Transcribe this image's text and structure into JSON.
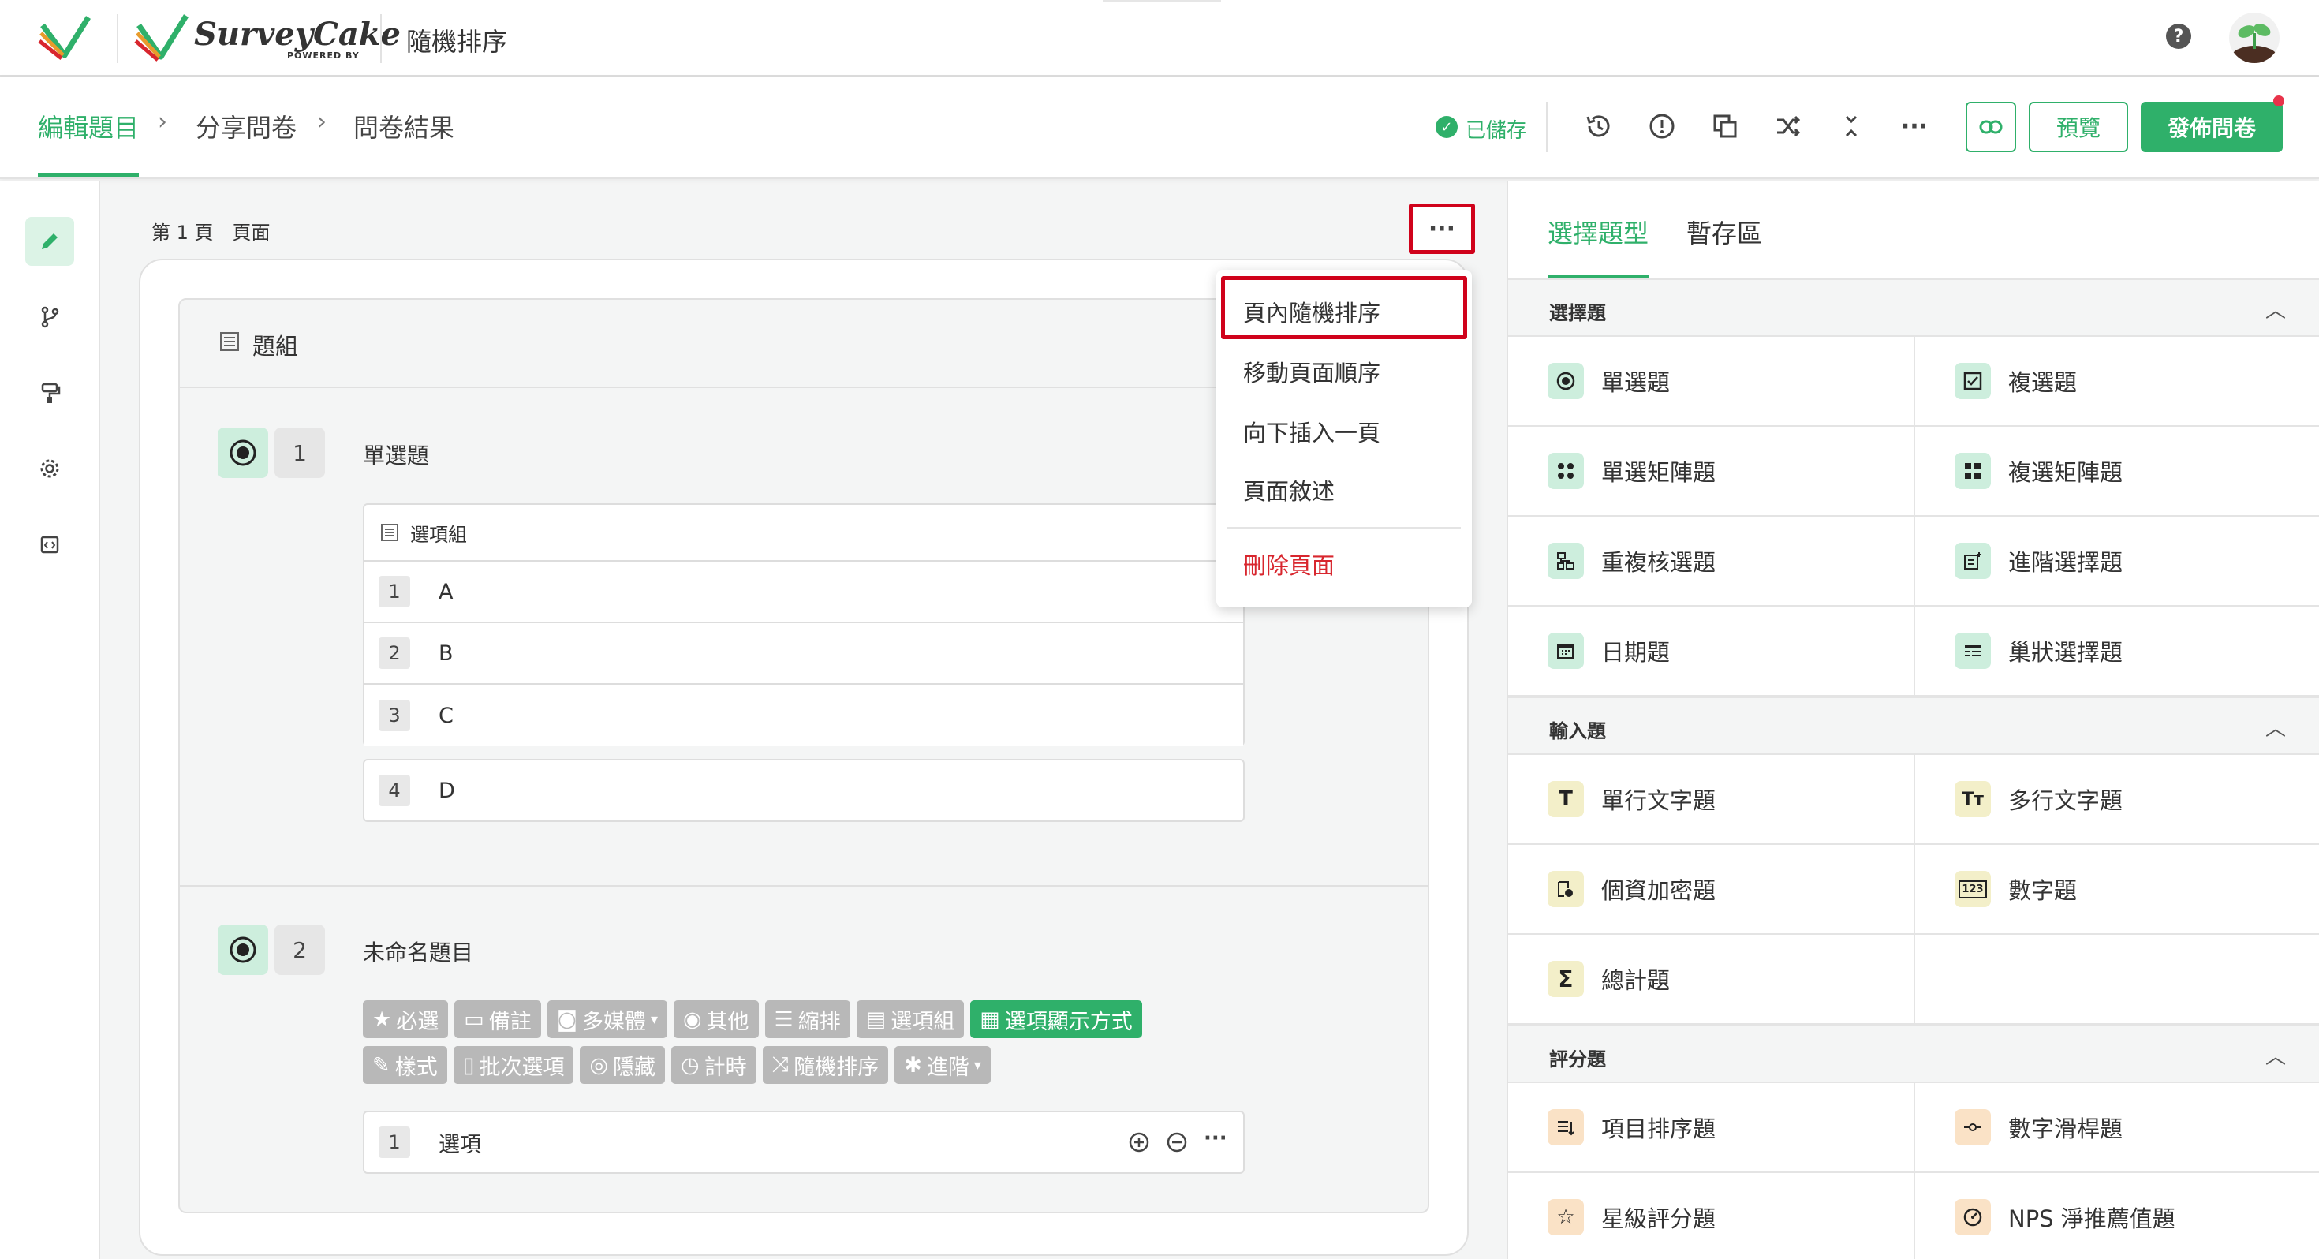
{
  "header": {
    "app_title": "隨機排序",
    "brand_name": "SurveyCake",
    "brand_sub": "POWERED BY"
  },
  "breadcrumb": {
    "items": [
      "編輯題目",
      "分享問卷",
      "問卷結果"
    ]
  },
  "toolbar": {
    "saved_label": "已儲存",
    "preview_label": "預覽",
    "publish_label": "發佈問卷"
  },
  "page": {
    "label": "第 1 頁",
    "name": "頁面"
  },
  "group": {
    "label": "題組"
  },
  "questions": [
    {
      "number": "1",
      "title": "單選題",
      "option_group_label": "選項組",
      "options": [
        {
          "num": "1",
          "text": "A"
        },
        {
          "num": "2",
          "text": "B"
        },
        {
          "num": "3",
          "text": "C"
        },
        {
          "num": "4",
          "text": "D"
        }
      ]
    },
    {
      "number": "2",
      "title": "未命名題目",
      "chips_row1": [
        "必選",
        "備註",
        "多媒體",
        "其他",
        "縮排",
        "選項組",
        "選項顯示方式"
      ],
      "chips_row2": [
        "樣式",
        "批次選項",
        "隱藏",
        "計時",
        "隨機排序",
        "進階"
      ],
      "options": [
        {
          "num": "1",
          "text": "選項"
        }
      ]
    }
  ],
  "menu": {
    "items": [
      "頁內隨機排序",
      "移動頁面順序",
      "向下插入一頁",
      "頁面敘述"
    ],
    "delete_label": "刪除頁面"
  },
  "right_panel": {
    "tabs": [
      "選擇題型",
      "暫存區"
    ],
    "sections": [
      {
        "title": "選擇題",
        "items": [
          "單選題",
          "複選題",
          "單選矩陣題",
          "複選矩陣題",
          "重複核選題",
          "進階選擇題",
          "日期題",
          "巢狀選擇題"
        ]
      },
      {
        "title": "輸入題",
        "items": [
          "單行文字題",
          "多行文字題",
          "個資加密題",
          "數字題",
          "總計題"
        ]
      },
      {
        "title": "評分題",
        "items": [
          "項目排序題",
          "數字滑桿題",
          "星級評分題",
          "NPS 淨推薦值題"
        ]
      }
    ]
  },
  "colors": {
    "accent": "#2fb06a",
    "danger": "#d8262e",
    "highlight_border": "#d0021b"
  }
}
